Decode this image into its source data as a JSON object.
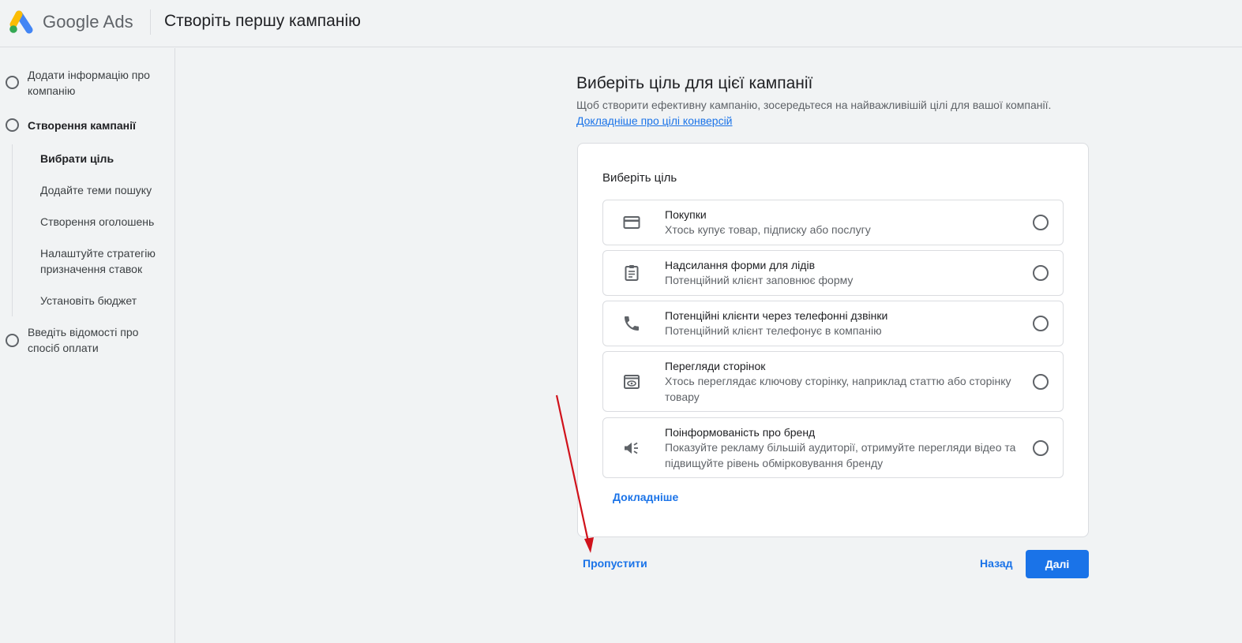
{
  "header": {
    "brand": "Google Ads",
    "page_title": "Створіть першу кампанію"
  },
  "sidebar": {
    "steps": [
      {
        "label": "Додати інформацію про компанію"
      },
      {
        "label": "Створення кампанії"
      },
      {
        "label": "Введіть відомості про спосіб оплати"
      }
    ],
    "substeps": [
      {
        "label": "Вибрати ціль"
      },
      {
        "label": "Додайте теми пошуку"
      },
      {
        "label": "Створення оголошень"
      },
      {
        "label": "Налаштуйте стратегію призначення ставок"
      },
      {
        "label": "Установіть бюджет"
      }
    ]
  },
  "main": {
    "heading": "Виберіть ціль для цієї кампанії",
    "subtitle": "Щоб створити ефективну кампанію, зосередьтеся на найважливішій цілі для вашої компанії.",
    "link": "Докладніше про цілі конверсій"
  },
  "card": {
    "title": "Виберіть ціль",
    "options": [
      {
        "title": "Покупки",
        "desc": "Хтось купує товар, підписку або послугу",
        "icon": "credit-card-icon"
      },
      {
        "title": "Надсилання форми для лідів",
        "desc": "Потенційний клієнт заповнює форму",
        "icon": "clipboard-icon"
      },
      {
        "title": "Потенційні клієнти через телефонні дзвінки",
        "desc": "Потенційний клієнт телефонує в компанію",
        "icon": "phone-icon"
      },
      {
        "title": "Перегляди сторінок",
        "desc": "Хтось переглядає ключову сторінку, наприклад статтю або сторінку товару",
        "icon": "page-view-icon"
      },
      {
        "title": "Поінформованість про бренд",
        "desc": "Показуйте рекламу більшій аудиторії, отримуйте перегляди відео та підвищуйте рівень обмірковування бренду",
        "icon": "megaphone-icon"
      }
    ],
    "more_link": "Докладніше"
  },
  "footer": {
    "skip": "Пропустити",
    "back": "Назад",
    "next": "Далі"
  },
  "colors": {
    "accent": "#1a73e8",
    "annotation_arrow": "#d0121b"
  }
}
